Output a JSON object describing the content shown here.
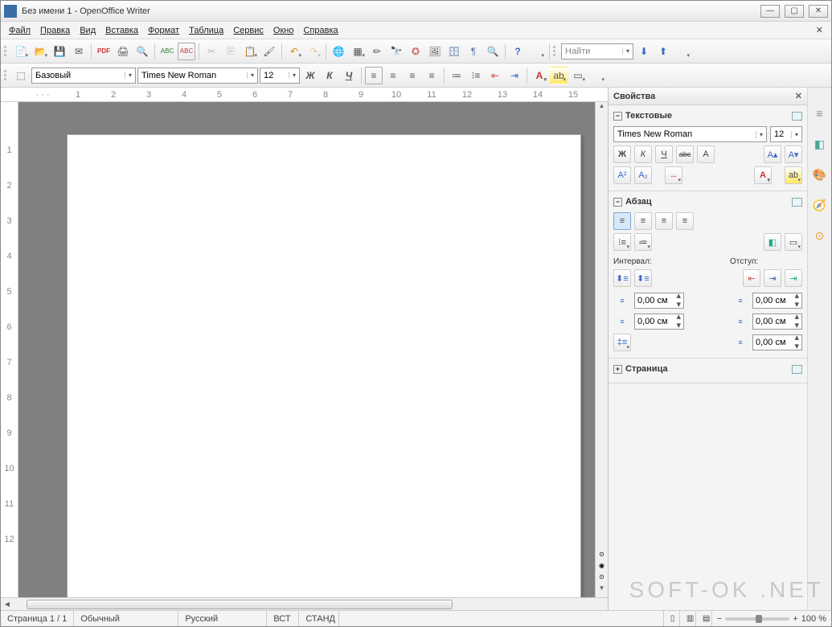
{
  "title": "Без имени 1 - OpenOffice Writer",
  "menu": [
    "Файл",
    "Правка",
    "Вид",
    "Вставка",
    "Формат",
    "Таблица",
    "Сервис",
    "Окно",
    "Справка"
  ],
  "search_placeholder": "Найти",
  "formatting": {
    "style_combo": "Базовый",
    "font_combo": "Times New Roman",
    "size_combo": "12",
    "bold": "Ж",
    "italic": "К",
    "underline": "Ч"
  },
  "ruler_h": [
    "1",
    "2",
    "3",
    "4",
    "5",
    "6",
    "7",
    "8",
    "9",
    "10",
    "11",
    "12",
    "13",
    "14",
    "15"
  ],
  "ruler_v": [
    "1",
    "2",
    "3",
    "4",
    "5",
    "6",
    "7",
    "8",
    "9",
    "10",
    "11",
    "12"
  ],
  "sidebar": {
    "title": "Свойства",
    "text_section": "Текстовые",
    "font": "Times New Roman",
    "size": "12",
    "bold": "Ж",
    "italic": "К",
    "underline": "Ч",
    "strike": "abc",
    "para_section": "Абзац",
    "interval_label": "Интервал:",
    "indent_label": "Отступ:",
    "sp1": "0,00 см",
    "sp2": "0,00 см",
    "sp3": "0,00 см",
    "sp4": "0,00 см",
    "sp5": "0,00 см",
    "page_section": "Страница"
  },
  "status": {
    "page": "Страница 1 / 1",
    "style": "Обычный",
    "lang": "Русский",
    "ins": "ВСТ",
    "std": "СТАНД",
    "zoom": "100 %"
  },
  "watermark": "SOFT-OK .NET"
}
